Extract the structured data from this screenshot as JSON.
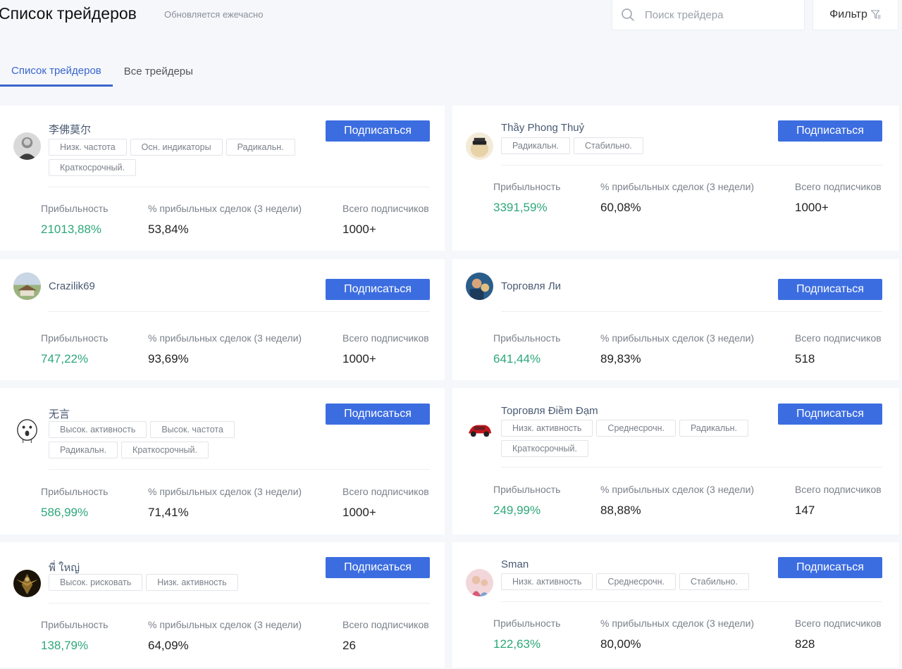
{
  "header": {
    "title": "Список трейдеров",
    "subtitle": "Обновляется ежечасно",
    "search_placeholder": "Поиск трейдера",
    "filter_label": "Фильтр"
  },
  "tabs": [
    {
      "label": "Список трейдеров",
      "active": true
    },
    {
      "label": "Все трейдеры",
      "active": false
    }
  ],
  "stat_labels": {
    "profit": "Прибыльность",
    "win_rate": "% прибыльных сделок (3 недели)",
    "followers": "Всего подписчиков"
  },
  "subscribe_label": "Подписаться",
  "colors": {
    "accent": "#3c6de0",
    "profit_green": "#2ea77a"
  },
  "traders": [
    {
      "name": "李佛莫尔",
      "tags": [
        "Низк. частота",
        "Осн. индикаторы",
        "Радикальн.",
        "Краткосрочный."
      ],
      "profit": "21013,88%",
      "win_rate": "53,84%",
      "followers": "1000+"
    },
    {
      "name": "Thầy Phong Thuỷ",
      "tags": [
        "Радикальн.",
        "Стабильно."
      ],
      "profit": "3391,59%",
      "win_rate": "60,08%",
      "followers": "1000+"
    },
    {
      "name": "Crazilik69",
      "tags": [],
      "profit": "747,22%",
      "win_rate": "93,69%",
      "followers": "1000+"
    },
    {
      "name": "Торговля Ли",
      "tags": [],
      "profit": "641,44%",
      "win_rate": "89,83%",
      "followers": "518"
    },
    {
      "name": "无言",
      "tags": [
        "Высок. активность",
        "Высок. частота",
        "Радикальн.",
        "Краткосрочный."
      ],
      "profit": "586,99%",
      "win_rate": "71,41%",
      "followers": "1000+"
    },
    {
      "name": "Торговля Điềm Đạm",
      "tags": [
        "Низк. активность",
        "Среднесрочн.",
        "Радикальн.",
        "Краткосрочный."
      ],
      "profit": "249,99%",
      "win_rate": "88,88%",
      "followers": "147"
    },
    {
      "name": "พี่ ใหญ่",
      "tags": [
        "Высок. рисковать",
        "Низк. активность"
      ],
      "profit": "138,79%",
      "win_rate": "64,09%",
      "followers": "26"
    },
    {
      "name": "Sman",
      "tags": [
        "Низк. активность",
        "Среднесрочн.",
        "Стабильно."
      ],
      "profit": "122,63%",
      "win_rate": "80,00%",
      "followers": "828"
    }
  ]
}
